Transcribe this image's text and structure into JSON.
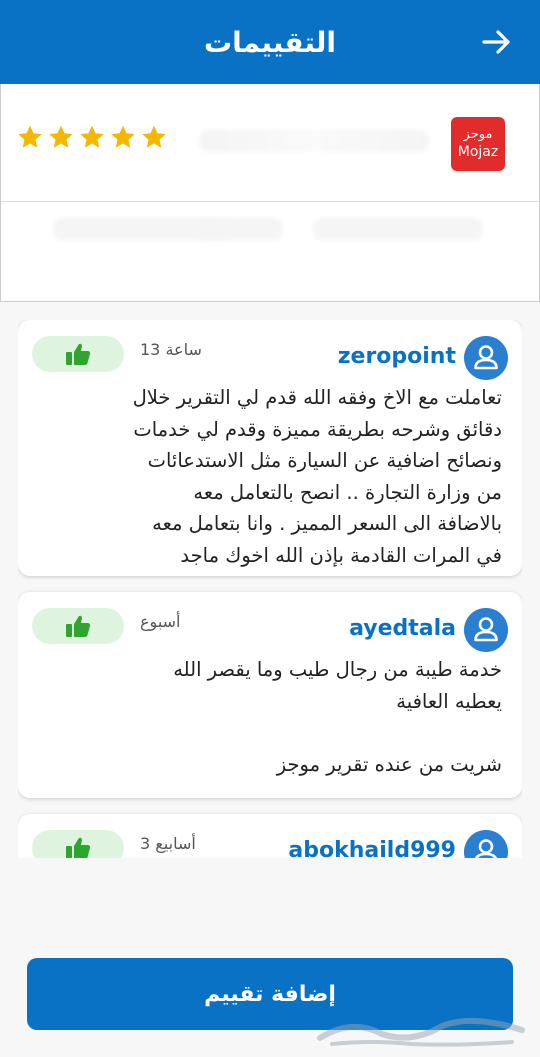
{
  "header": {
    "title": "التقييمات"
  },
  "product": {
    "logo_ar": "موجز",
    "logo_en": "Mojaz",
    "rating": 5
  },
  "reviews": [
    {
      "username": "zeropoint",
      "time": "13 ساعة",
      "text": "تعاملت مع الاخ وفقه الله قدم لي التقرير خلال\nدقائق وشرحه بطريقة مميزة وقدم لي خدمات\nونصائح اضافية عن السيارة مثل الاستدعائات\nمن وزارة التجارة .. انصح بالتعامل معه\nبالاضافة الى السعر المميز .  وانا بتعامل معه\nفي المرات القادمة بإذن الله اخوك ماجد"
    },
    {
      "username": "ayedtala",
      "time": "أسبوع",
      "text": "خدمة طيبة من رجال طيب وما يقصر الله\nيعطيه العافية\n\nشريت من عنده تقرير موجز"
    },
    {
      "username": "abokhaild999",
      "time": "3 أسابيع",
      "text": ""
    }
  ],
  "footer": {
    "add_review_label": "إضافة تقييم"
  },
  "colors": {
    "primary": "#0a72c5",
    "star": "#f5b800",
    "like_bg": "#def4df",
    "like_icon": "#2fa52f"
  }
}
